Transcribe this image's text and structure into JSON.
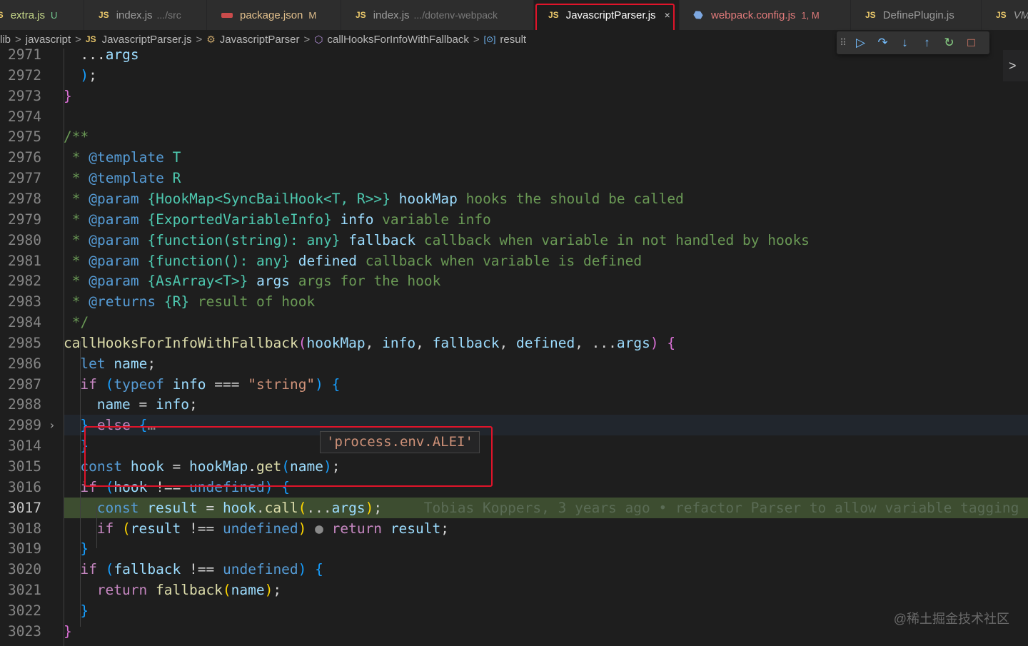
{
  "tabs": [
    {
      "name": "extra.js",
      "status": "U",
      "dir": "",
      "icon": "js-icon"
    },
    {
      "name": "index.js",
      "status": "",
      "dir": ".../src",
      "icon": "js-icon"
    },
    {
      "name": "package.json",
      "status": "M",
      "dir": "",
      "icon": "package-json-icon"
    },
    {
      "name": "index.js",
      "status": "",
      "dir": ".../dotenv-webpack",
      "icon": "js-icon"
    },
    {
      "name": "JavascriptParser.js",
      "status": "",
      "dir": "",
      "icon": "js-icon",
      "active": true
    },
    {
      "name": "webpack.config.js",
      "status": "1, M",
      "dir": "",
      "icon": "webpack-icon"
    },
    {
      "name": "DefinePlugin.js",
      "status": "",
      "dir": "",
      "icon": "js-icon"
    },
    {
      "name": "VM",
      "status": "",
      "dir": "",
      "icon": "js-icon"
    }
  ],
  "tab_icon_label": "JS",
  "tab_close": "×",
  "breadcrumb": {
    "items": [
      "lib",
      "javascript",
      "JavascriptParser.js",
      "JavascriptParser",
      "callHooksForInfoWithFallback",
      "result"
    ],
    "separator": ">"
  },
  "debug_toolbar": [
    "drag-handle-icon",
    "continue-icon",
    "step-over-icon",
    "step-into-icon",
    "step-out-icon",
    "restart-icon",
    "stop-icon"
  ],
  "side_arrow": ">",
  "hover_value": "'process.env.ALEI'",
  "blame": "Tobias Koppers, 3 years ago • refactor Parser to allow variable tagging",
  "watermark": "@稀土掘金技术社区",
  "colors": {
    "accent_red": "#e0142a",
    "exec_line": "#3d4d30",
    "keyword": "#569cd6",
    "comment": "#6a9955",
    "string": "#ce9178"
  },
  "lines": [
    {
      "n": "2971",
      "tokens": [
        [
          "pl",
          "  ..."
        ],
        [
          "var",
          "args"
        ]
      ]
    },
    {
      "n": "2972",
      "tokens": [
        [
          "pl",
          " "
        ],
        [
          "br3",
          ")"
        ],
        [
          "pl",
          ";"
        ]
      ]
    },
    {
      "n": "2973",
      "tokens": [
        [
          "br2",
          "}"
        ]
      ]
    },
    {
      "n": "2974",
      "tokens": []
    },
    {
      "n": "2975",
      "tokens": [
        [
          "cm",
          "/**"
        ]
      ]
    },
    {
      "n": "2976",
      "tokens": [
        [
          "cm",
          " * "
        ],
        [
          "kw",
          "@template"
        ],
        [
          "pl",
          " "
        ],
        [
          "ty",
          "T"
        ]
      ]
    },
    {
      "n": "2977",
      "tokens": [
        [
          "cm",
          " * "
        ],
        [
          "kw",
          "@template"
        ],
        [
          "pl",
          " "
        ],
        [
          "ty",
          "R"
        ]
      ]
    },
    {
      "n": "2978",
      "tokens": [
        [
          "cm",
          " * "
        ],
        [
          "kw",
          "@param"
        ],
        [
          "pl",
          " "
        ],
        [
          "ty",
          "{HookMap<SyncBailHook<T, R>>}"
        ],
        [
          "pl",
          " "
        ],
        [
          "var",
          "hookMap"
        ],
        [
          "cm",
          " hooks the should be called"
        ]
      ]
    },
    {
      "n": "2979",
      "tokens": [
        [
          "cm",
          " * "
        ],
        [
          "kw",
          "@param"
        ],
        [
          "pl",
          " "
        ],
        [
          "ty",
          "{ExportedVariableInfo}"
        ],
        [
          "pl",
          " "
        ],
        [
          "var",
          "info"
        ],
        [
          "cm",
          " variable info"
        ]
      ]
    },
    {
      "n": "2980",
      "tokens": [
        [
          "cm",
          " * "
        ],
        [
          "kw",
          "@param"
        ],
        [
          "pl",
          " "
        ],
        [
          "ty",
          "{function(string): any}"
        ],
        [
          "pl",
          " "
        ],
        [
          "var",
          "fallback"
        ],
        [
          "cm",
          " callback when variable in not handled by hooks"
        ]
      ]
    },
    {
      "n": "2981",
      "tokens": [
        [
          "cm",
          " * "
        ],
        [
          "kw",
          "@param"
        ],
        [
          "pl",
          " "
        ],
        [
          "ty",
          "{function(): any}"
        ],
        [
          "pl",
          " "
        ],
        [
          "var",
          "defined"
        ],
        [
          "cm",
          " callback when variable is defined"
        ]
      ]
    },
    {
      "n": "2982",
      "tokens": [
        [
          "cm",
          " * "
        ],
        [
          "kw",
          "@param"
        ],
        [
          "pl",
          " "
        ],
        [
          "ty",
          "{AsArray<T>}"
        ],
        [
          "pl",
          " "
        ],
        [
          "var",
          "args"
        ],
        [
          "cm",
          " args for the hook"
        ]
      ]
    },
    {
      "n": "2983",
      "tokens": [
        [
          "cm",
          " * "
        ],
        [
          "kw",
          "@returns"
        ],
        [
          "pl",
          " "
        ],
        [
          "ty",
          "{R}"
        ],
        [
          "cm",
          " result of hook"
        ]
      ]
    },
    {
      "n": "2984",
      "tokens": [
        [
          "cm",
          " */"
        ]
      ]
    },
    {
      "n": "2985",
      "tokens": [
        [
          "fn",
          "callHooksForInfoWithFallback"
        ],
        [
          "br2",
          "("
        ],
        [
          "var",
          "hookMap"
        ],
        [
          "pl",
          ", "
        ],
        [
          "var",
          "info"
        ],
        [
          "pl",
          ", "
        ],
        [
          "var",
          "fallback"
        ],
        [
          "pl",
          ", "
        ],
        [
          "var",
          "defined"
        ],
        [
          "pl",
          ", ..."
        ],
        [
          "var",
          "args"
        ],
        [
          "br2",
          ")"
        ],
        [
          "pl",
          " "
        ],
        [
          "br2",
          "{"
        ]
      ]
    },
    {
      "n": "2986",
      "tokens": [
        [
          "pl",
          " "
        ],
        [
          "kw",
          "let"
        ],
        [
          "pl",
          " "
        ],
        [
          "var",
          "name"
        ],
        [
          "pl",
          ";"
        ]
      ]
    },
    {
      "n": "2987",
      "tokens": [
        [
          "pl",
          " "
        ],
        [
          "kw2",
          "if"
        ],
        [
          "pl",
          " "
        ],
        [
          "br3",
          "("
        ],
        [
          "kw",
          "typeof"
        ],
        [
          "pl",
          " "
        ],
        [
          "var",
          "info"
        ],
        [
          "pl",
          " === "
        ],
        [
          "str",
          "\"string\""
        ],
        [
          "br3",
          ")"
        ],
        [
          "pl",
          " "
        ],
        [
          "br3",
          "{"
        ]
      ]
    },
    {
      "n": "2988",
      "tokens": [
        [
          "pl",
          "  "
        ],
        [
          "var",
          "name"
        ],
        [
          "pl",
          " = "
        ],
        [
          "var",
          "info"
        ],
        [
          "pl",
          ";"
        ]
      ]
    },
    {
      "n": "2989",
      "tokens": [
        [
          "pl",
          " "
        ],
        [
          "br3",
          "}"
        ],
        [
          "pl",
          " "
        ],
        [
          "kw2",
          "else"
        ],
        [
          "pl",
          " "
        ],
        [
          "br3",
          "{"
        ],
        [
          "bp-dot",
          "…"
        ]
      ],
      "fold": true
    },
    {
      "n": "3014",
      "tokens": [
        [
          "pl",
          " "
        ],
        [
          "br3",
          "}"
        ]
      ]
    },
    {
      "n": "3015",
      "tokens": [
        [
          "pl",
          " "
        ],
        [
          "kw",
          "const"
        ],
        [
          "pl",
          " "
        ],
        [
          "var",
          "hook"
        ],
        [
          "pl",
          " = "
        ],
        [
          "var",
          "hookMap"
        ],
        [
          "pl",
          "."
        ],
        [
          "fn",
          "get"
        ],
        [
          "br3",
          "("
        ],
        [
          "var",
          "name"
        ],
        [
          "br3",
          ")"
        ],
        [
          "pl",
          ";"
        ]
      ]
    },
    {
      "n": "3016",
      "tokens": [
        [
          "pl",
          " "
        ],
        [
          "kw2",
          "if"
        ],
        [
          "pl",
          " "
        ],
        [
          "br3",
          "("
        ],
        [
          "var",
          "hook"
        ],
        [
          "pl",
          " !== "
        ],
        [
          "kw",
          "undefined"
        ],
        [
          "br3",
          ")"
        ],
        [
          "pl",
          " "
        ],
        [
          "br3",
          "{"
        ]
      ]
    },
    {
      "n": "3017",
      "tokens": [
        [
          "pl",
          "  "
        ],
        [
          "kw",
          "const"
        ],
        [
          "pl",
          " "
        ],
        [
          "var",
          "result"
        ],
        [
          "pl",
          " = "
        ],
        [
          "var",
          "hook"
        ],
        [
          "pl",
          "."
        ],
        [
          "fn",
          "call"
        ],
        [
          "br1",
          "("
        ],
        [
          "pl",
          "..."
        ],
        [
          "var",
          "args"
        ],
        [
          "br1",
          ")"
        ],
        [
          "pl",
          ";"
        ],
        [
          "blame",
          "     Tobias Koppers, 3 years ago • refactor Parser to allow variable tagging"
        ]
      ],
      "exec": true
    },
    {
      "n": "3018",
      "tokens": [
        [
          "pl",
          "  "
        ],
        [
          "kw2",
          "if"
        ],
        [
          "pl",
          " "
        ],
        [
          "br1",
          "("
        ],
        [
          "var",
          "result"
        ],
        [
          "pl",
          " !== "
        ],
        [
          "kw",
          "undefined"
        ],
        [
          "br1",
          ")"
        ],
        [
          "pl",
          " "
        ],
        [
          "bp-dot",
          "●"
        ],
        [
          "pl",
          " "
        ],
        [
          "kw2",
          "return"
        ],
        [
          "pl",
          " "
        ],
        [
          "var",
          "result"
        ],
        [
          "pl",
          ";"
        ]
      ]
    },
    {
      "n": "3019",
      "tokens": [
        [
          "pl",
          " "
        ],
        [
          "br3",
          "}"
        ]
      ]
    },
    {
      "n": "3020",
      "tokens": [
        [
          "pl",
          " "
        ],
        [
          "kw2",
          "if"
        ],
        [
          "pl",
          " "
        ],
        [
          "br3",
          "("
        ],
        [
          "var",
          "fallback"
        ],
        [
          "pl",
          " !== "
        ],
        [
          "kw",
          "undefined"
        ],
        [
          "br3",
          ")"
        ],
        [
          "pl",
          " "
        ],
        [
          "br3",
          "{"
        ]
      ]
    },
    {
      "n": "3021",
      "tokens": [
        [
          "pl",
          "  "
        ],
        [
          "kw2",
          "return"
        ],
        [
          "pl",
          " "
        ],
        [
          "fn",
          "fallback"
        ],
        [
          "br1",
          "("
        ],
        [
          "var",
          "name"
        ],
        [
          "br1",
          ")"
        ],
        [
          "pl",
          ";"
        ]
      ]
    },
    {
      "n": "3022",
      "tokens": [
        [
          "pl",
          " "
        ],
        [
          "br3",
          "}"
        ]
      ]
    },
    {
      "n": "3023",
      "tokens": [
        [
          "br2",
          "}"
        ]
      ]
    }
  ]
}
